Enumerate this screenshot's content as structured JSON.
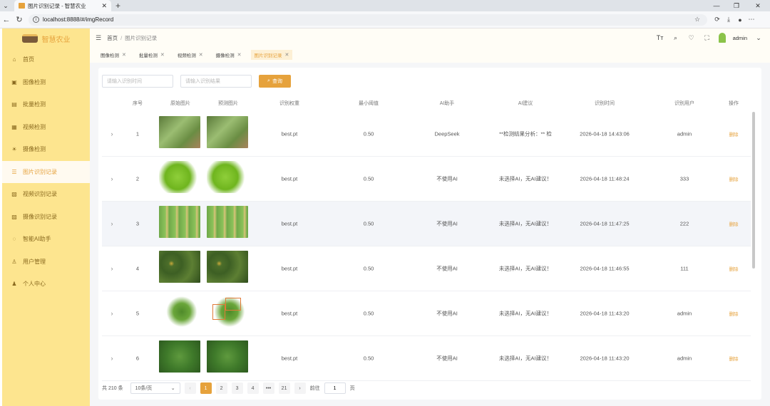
{
  "browser": {
    "tab_title": "图片识别记录 - 智慧农业",
    "url": "localhost:8888/#/imgRecord"
  },
  "app": {
    "name": "智慧农业",
    "user": "admin"
  },
  "sidebar": {
    "items": [
      {
        "label": "首页",
        "icon": "home-icon"
      },
      {
        "label": "图像检测",
        "icon": "image-icon"
      },
      {
        "label": "批量检测",
        "icon": "batch-icon"
      },
      {
        "label": "视频检测",
        "icon": "video-icon"
      },
      {
        "label": "摄像检测",
        "icon": "camera-icon"
      },
      {
        "label": "图片识别记录",
        "icon": "record-icon",
        "active": true
      },
      {
        "label": "视频识别记录",
        "icon": "video-record-icon"
      },
      {
        "label": "摄像识别记录",
        "icon": "camera-record-icon"
      },
      {
        "label": "智能AI助手",
        "icon": "ai-chat-icon"
      },
      {
        "label": "用户管理",
        "icon": "users-icon"
      },
      {
        "label": "个人中心",
        "icon": "profile-icon"
      }
    ]
  },
  "breadcrumb": {
    "home": "首页",
    "current": "图片识别记录"
  },
  "tags": [
    {
      "label": "图像检测"
    },
    {
      "label": "批量检测"
    },
    {
      "label": "视频检测"
    },
    {
      "label": "摄像检测"
    },
    {
      "label": "图片识别记录",
      "active": true
    }
  ],
  "search": {
    "time_placeholder": "请输入识别时间",
    "result_placeholder": "请输入识别结果",
    "button_label": "查询"
  },
  "table": {
    "headers": [
      "序号",
      "原始图片",
      "预测图片",
      "识别权重",
      "最小阈值",
      "AI助手",
      "AI建议",
      "识别时间",
      "识别用户",
      "操作"
    ],
    "rows": [
      {
        "index": "1",
        "weight": "best.pt",
        "threshold": "0.50",
        "ai": "DeepSeek",
        "suggestion": "**检测结果分析：** 检",
        "time": "2026-04-18 14:43:06",
        "user": "admin",
        "action": "删除"
      },
      {
        "index": "2",
        "weight": "best.pt",
        "threshold": "0.50",
        "ai": "不使用AI",
        "suggestion": "未选择AI，无AI建议！",
        "time": "2026-04-18 11:48:24",
        "user": "333",
        "action": "删除"
      },
      {
        "index": "3",
        "weight": "best.pt",
        "threshold": "0.50",
        "ai": "不使用AI",
        "suggestion": "未选择AI，无AI建议！",
        "time": "2026-04-18 11:47:25",
        "user": "222",
        "action": "删除"
      },
      {
        "index": "4",
        "weight": "best.pt",
        "threshold": "0.50",
        "ai": "不使用AI",
        "suggestion": "未选择AI，无AI建议！",
        "time": "2026-04-18 11:46:55",
        "user": "111",
        "action": "删除"
      },
      {
        "index": "5",
        "weight": "best.pt",
        "threshold": "0.50",
        "ai": "不使用AI",
        "suggestion": "未选择AI，无AI建议！",
        "time": "2026-04-18 11:43:20",
        "user": "admin",
        "action": "删除"
      },
      {
        "index": "6",
        "weight": "best.pt",
        "threshold": "0.50",
        "ai": "不使用AI",
        "suggestion": "未选择AI，无AI建议！",
        "time": "2026-04-18 11:43:20",
        "user": "admin",
        "action": "删除"
      }
    ]
  },
  "pagination": {
    "total": "共 210 条",
    "page_size": "10条/页",
    "pages": [
      "1",
      "2",
      "3",
      "4",
      "•••",
      "21"
    ],
    "current": "1",
    "jump_label": "前往",
    "jump_value": "1",
    "jump_unit": "页"
  },
  "colors": {
    "accent": "#e6a23c",
    "sidebar": "#fde58f"
  }
}
